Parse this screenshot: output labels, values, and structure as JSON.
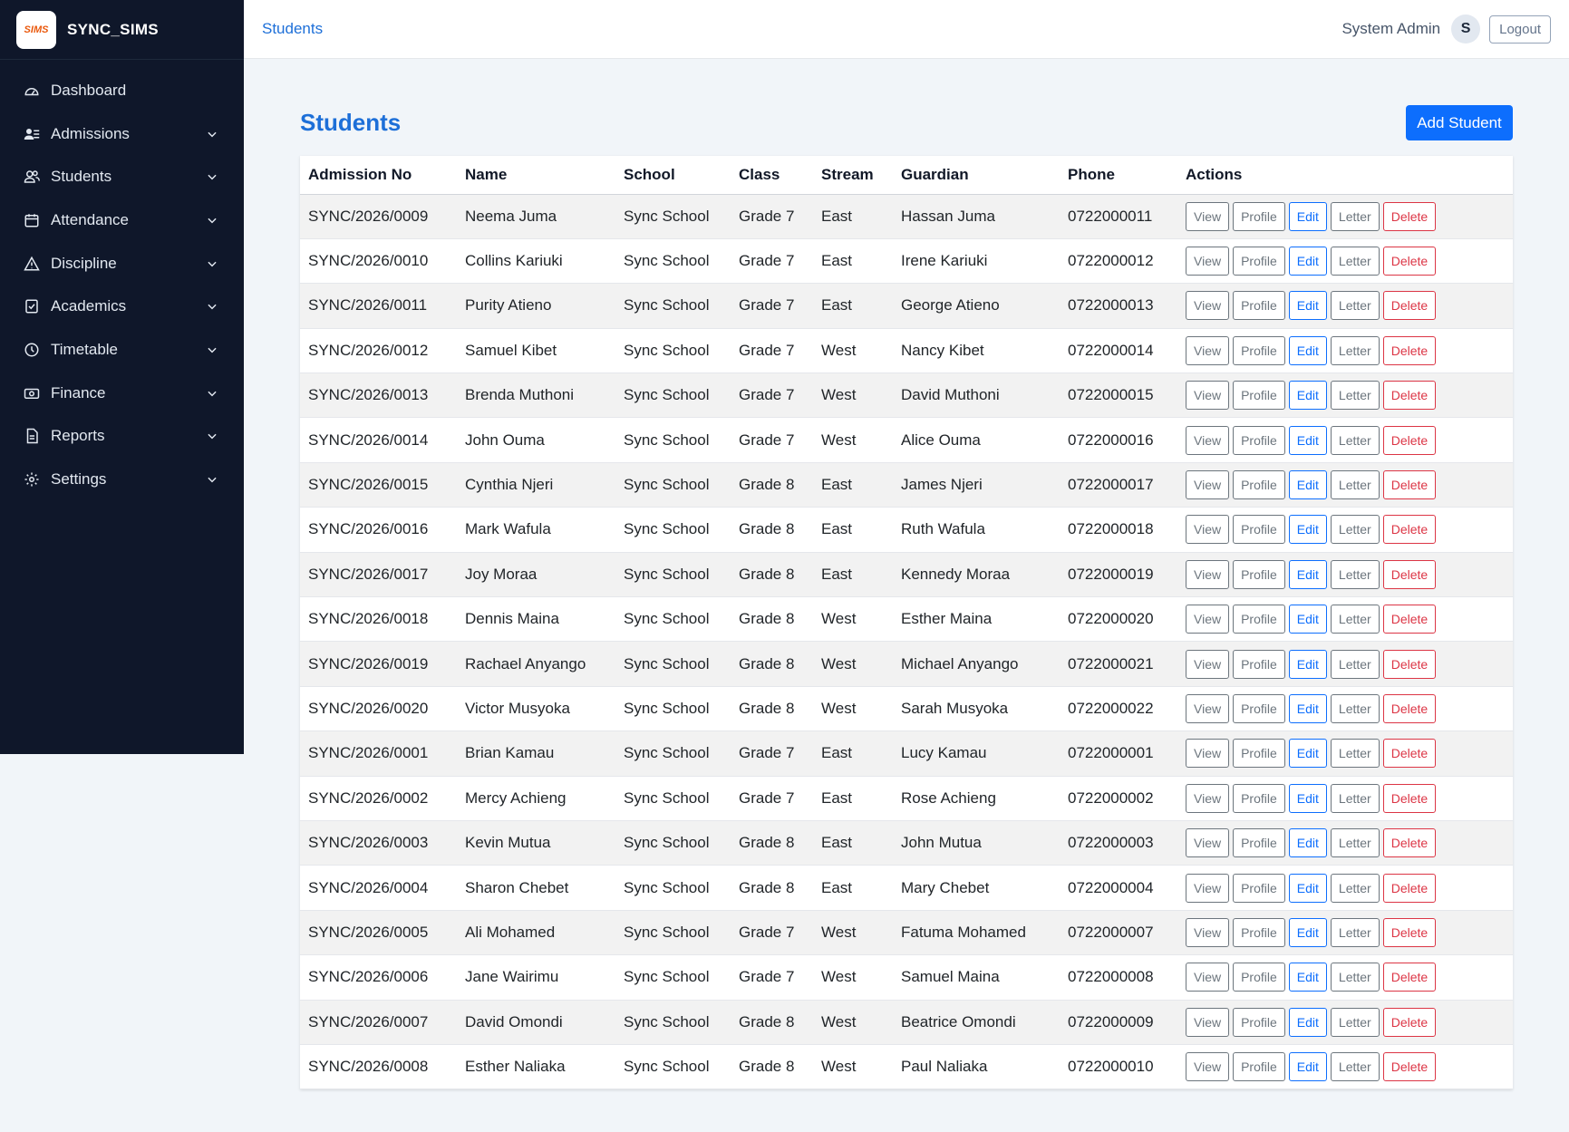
{
  "app": {
    "logo_text": "SIMS",
    "name": "SYNC_SIMS"
  },
  "sidebar": {
    "items": [
      {
        "label": "Dashboard",
        "icon": "dashboard-icon",
        "has_chevron": false
      },
      {
        "label": "Admissions",
        "icon": "admissions-icon",
        "has_chevron": true
      },
      {
        "label": "Students",
        "icon": "students-icon",
        "has_chevron": true
      },
      {
        "label": "Attendance",
        "icon": "attendance-icon",
        "has_chevron": true
      },
      {
        "label": "Discipline",
        "icon": "discipline-icon",
        "has_chevron": true
      },
      {
        "label": "Academics",
        "icon": "academics-icon",
        "has_chevron": true
      },
      {
        "label": "Timetable",
        "icon": "timetable-icon",
        "has_chevron": true
      },
      {
        "label": "Finance",
        "icon": "finance-icon",
        "has_chevron": true
      },
      {
        "label": "Reports",
        "icon": "reports-icon",
        "has_chevron": true
      },
      {
        "label": "Settings",
        "icon": "settings-icon",
        "has_chevron": true
      }
    ]
  },
  "topbar": {
    "breadcrumb": "Students",
    "user_name": "System Admin",
    "avatar_initial": "S",
    "logout_label": "Logout"
  },
  "page": {
    "title": "Students",
    "add_button": "Add Student"
  },
  "table": {
    "columns": [
      "Admission No",
      "Name",
      "School",
      "Class",
      "Stream",
      "Guardian",
      "Phone",
      "Actions"
    ],
    "action_labels": {
      "view": "View",
      "profile": "Profile",
      "edit": "Edit",
      "letter": "Letter",
      "delete": "Delete"
    },
    "rows": [
      [
        "SYNC/2026/0009",
        "Neema Juma",
        "Sync School",
        "Grade 7",
        "East",
        "Hassan Juma",
        "0722000011"
      ],
      [
        "SYNC/2026/0010",
        "Collins Kariuki",
        "Sync School",
        "Grade 7",
        "East",
        "Irene Kariuki",
        "0722000012"
      ],
      [
        "SYNC/2026/0011",
        "Purity Atieno",
        "Sync School",
        "Grade 7",
        "East",
        "George Atieno",
        "0722000013"
      ],
      [
        "SYNC/2026/0012",
        "Samuel Kibet",
        "Sync School",
        "Grade 7",
        "West",
        "Nancy Kibet",
        "0722000014"
      ],
      [
        "SYNC/2026/0013",
        "Brenda Muthoni",
        "Sync School",
        "Grade 7",
        "West",
        "David Muthoni",
        "0722000015"
      ],
      [
        "SYNC/2026/0014",
        "John Ouma",
        "Sync School",
        "Grade 7",
        "West",
        "Alice Ouma",
        "0722000016"
      ],
      [
        "SYNC/2026/0015",
        "Cynthia Njeri",
        "Sync School",
        "Grade 8",
        "East",
        "James Njeri",
        "0722000017"
      ],
      [
        "SYNC/2026/0016",
        "Mark Wafula",
        "Sync School",
        "Grade 8",
        "East",
        "Ruth Wafula",
        "0722000018"
      ],
      [
        "SYNC/2026/0017",
        "Joy Moraa",
        "Sync School",
        "Grade 8",
        "East",
        "Kennedy Moraa",
        "0722000019"
      ],
      [
        "SYNC/2026/0018",
        "Dennis Maina",
        "Sync School",
        "Grade 8",
        "West",
        "Esther Maina",
        "0722000020"
      ],
      [
        "SYNC/2026/0019",
        "Rachael Anyango",
        "Sync School",
        "Grade 8",
        "West",
        "Michael Anyango",
        "0722000021"
      ],
      [
        "SYNC/2026/0020",
        "Victor Musyoka",
        "Sync School",
        "Grade 8",
        "West",
        "Sarah Musyoka",
        "0722000022"
      ],
      [
        "SYNC/2026/0001",
        "Brian Kamau",
        "Sync School",
        "Grade 7",
        "East",
        "Lucy Kamau",
        "0722000001"
      ],
      [
        "SYNC/2026/0002",
        "Mercy Achieng",
        "Sync School",
        "Grade 7",
        "East",
        "Rose Achieng",
        "0722000002"
      ],
      [
        "SYNC/2026/0003",
        "Kevin Mutua",
        "Sync School",
        "Grade 8",
        "East",
        "John Mutua",
        "0722000003"
      ],
      [
        "SYNC/2026/0004",
        "Sharon Chebet",
        "Sync School",
        "Grade 8",
        "East",
        "Mary Chebet",
        "0722000004"
      ],
      [
        "SYNC/2026/0005",
        "Ali Mohamed",
        "Sync School",
        "Grade 7",
        "West",
        "Fatuma Mohamed",
        "0722000007"
      ],
      [
        "SYNC/2026/0006",
        "Jane Wairimu",
        "Sync School",
        "Grade 7",
        "West",
        "Samuel Maina",
        "0722000008"
      ],
      [
        "SYNC/2026/0007",
        "David Omondi",
        "Sync School",
        "Grade 8",
        "West",
        "Beatrice Omondi",
        "0722000009"
      ],
      [
        "SYNC/2026/0008",
        "Esther Naliaka",
        "Sync School",
        "Grade 8",
        "West",
        "Paul Naliaka",
        "0722000010"
      ]
    ]
  },
  "colors": {
    "sidebar_bg": "#0f172a",
    "accent": "#1d6fd8",
    "primary_button": "#0d6efd",
    "danger": "#dc3545"
  }
}
